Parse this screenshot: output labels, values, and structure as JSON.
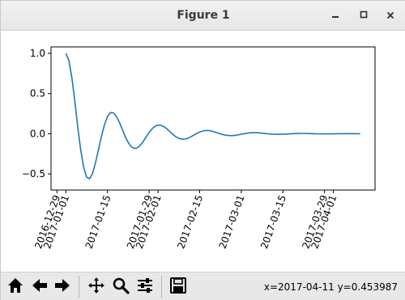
{
  "window": {
    "title": "Figure 1"
  },
  "window_controls": {
    "minimize": "minimize-icon",
    "maximize": "maximize-icon",
    "close": "close-icon"
  },
  "toolbar": {
    "buttons": [
      "home-icon",
      "back-icon",
      "forward-icon",
      "pan-icon",
      "zoom-icon",
      "configure-subplots-icon",
      "save-icon"
    ],
    "coords": "x=2017-04-11 y=0.453987"
  },
  "chart_data": {
    "type": "line",
    "series": [
      {
        "color": "#1f77b4",
        "x": [
          "2017-01-01",
          "2017-01-02",
          "2017-01-03",
          "2017-01-04",
          "2017-01-05",
          "2017-01-06",
          "2017-01-07",
          "2017-01-08",
          "2017-01-09",
          "2017-01-10",
          "2017-01-11",
          "2017-01-12",
          "2017-01-13",
          "2017-01-14",
          "2017-01-15",
          "2017-01-16",
          "2017-01-17",
          "2017-01-18",
          "2017-01-19",
          "2017-01-20",
          "2017-01-21",
          "2017-01-22",
          "2017-01-23",
          "2017-01-24",
          "2017-01-25",
          "2017-01-26",
          "2017-01-27",
          "2017-01-28",
          "2017-01-29",
          "2017-01-30",
          "2017-01-31",
          "2017-02-01",
          "2017-02-02",
          "2017-02-03",
          "2017-02-04",
          "2017-02-05",
          "2017-02-06",
          "2017-02-07",
          "2017-02-08",
          "2017-02-09",
          "2017-02-10",
          "2017-02-11",
          "2017-02-12",
          "2017-02-13",
          "2017-02-14",
          "2017-02-15",
          "2017-02-16",
          "2017-02-17",
          "2017-02-18",
          "2017-02-19",
          "2017-02-20",
          "2017-02-21",
          "2017-02-22",
          "2017-02-23",
          "2017-02-24",
          "2017-02-25",
          "2017-02-26",
          "2017-02-27",
          "2017-02-28",
          "2017-03-01",
          "2017-03-02",
          "2017-03-03",
          "2017-03-04",
          "2017-03-05",
          "2017-03-06",
          "2017-03-07",
          "2017-03-08",
          "2017-03-09",
          "2017-03-10",
          "2017-03-11",
          "2017-03-12",
          "2017-03-13",
          "2017-03-14",
          "2017-03-15",
          "2017-03-16",
          "2017-03-17",
          "2017-03-18",
          "2017-03-19",
          "2017-03-20",
          "2017-03-21",
          "2017-03-22",
          "2017-03-23",
          "2017-03-24",
          "2017-03-25",
          "2017-03-26",
          "2017-03-27",
          "2017-03-28",
          "2017-03-29",
          "2017-03-30",
          "2017-03-31",
          "2017-04-01",
          "2017-04-02",
          "2017-04-03",
          "2017-04-04",
          "2017-04-05",
          "2017-04-06",
          "2017-04-07",
          "2017-04-08",
          "2017-04-09",
          "2017-04-10"
        ],
        "y": [
          1.0,
          0.912,
          0.7,
          0.404,
          0.082,
          -0.207,
          -0.421,
          -0.54,
          -0.559,
          -0.489,
          -0.356,
          -0.191,
          -0.025,
          0.116,
          0.214,
          0.262,
          0.26,
          0.216,
          0.142,
          0.052,
          -0.037,
          -0.111,
          -0.161,
          -0.183,
          -0.176,
          -0.145,
          -0.097,
          -0.04,
          0.016,
          0.062,
          0.093,
          0.107,
          0.105,
          0.088,
          0.06,
          0.026,
          -0.008,
          -0.037,
          -0.057,
          -0.067,
          -0.066,
          -0.056,
          -0.039,
          -0.018,
          0.003,
          0.021,
          0.033,
          0.04,
          0.04,
          0.034,
          0.023,
          0.011,
          -0.002,
          -0.012,
          -0.019,
          -0.023,
          -0.023,
          -0.02,
          -0.013,
          -0.006,
          0.001,
          0.007,
          0.011,
          0.013,
          0.013,
          0.011,
          0.007,
          0.003,
          -0.001,
          -0.004,
          -0.006,
          -0.007,
          -0.007,
          -0.006,
          -0.004,
          -0.002,
          0.0,
          0.002,
          0.003,
          0.004,
          0.004,
          0.003,
          0.002,
          0.001,
          0.0,
          -0.001,
          -0.002,
          -0.002,
          -0.002,
          -0.002,
          -0.001,
          0.0,
          0.0,
          0.001,
          0.001,
          0.001,
          0.001,
          0.001,
          0.0,
          0.0
        ]
      }
    ],
    "xlim": [
      "2016-12-27",
      "2017-04-15"
    ],
    "ylim": [
      -0.7,
      1.08
    ],
    "xticks": [
      "2016-12-29",
      "2017-01-01",
      "2017-01-15",
      "2017-01-29",
      "2017-02-01",
      "2017-02-15",
      "2017-03-01",
      "2017-03-15",
      "2017-03-29",
      "2017-04-01"
    ],
    "yticks": [
      -0.5,
      0.0,
      0.5,
      1.0
    ],
    "yticklabels": [
      "−0.5",
      "0.0",
      "0.5",
      "1.0"
    ],
    "xtick_rotation": "70 degrees",
    "grid": false
  }
}
